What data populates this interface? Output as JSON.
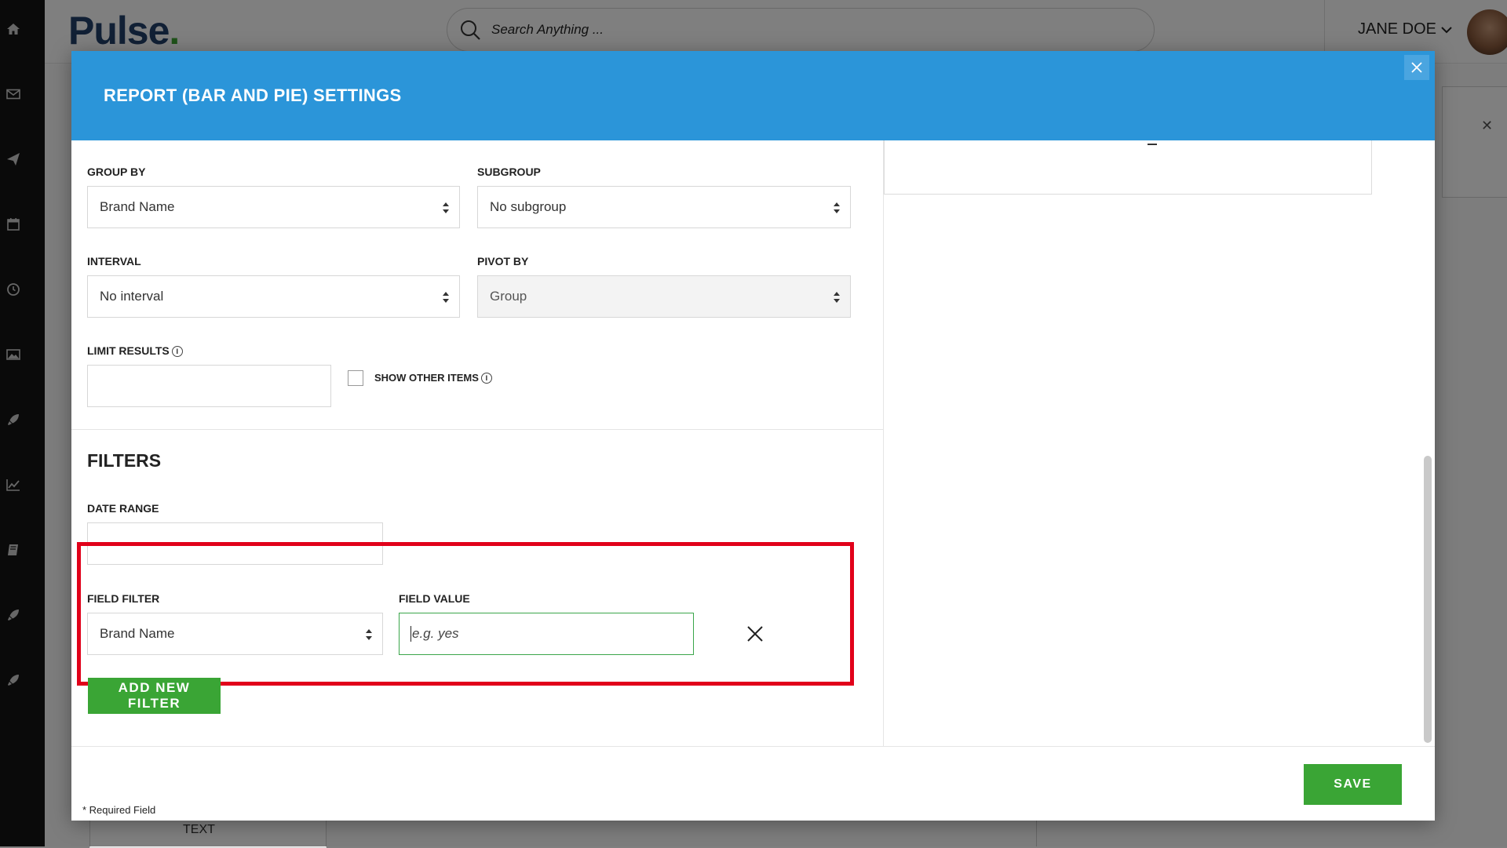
{
  "app": {
    "logo_text": "Pulse",
    "logo_dot": ".",
    "search": {
      "placeholder": "Search Anything ..."
    },
    "user": {
      "name": "JANE DOE"
    },
    "rail_icons": [
      "home-icon",
      "mail-icon",
      "send-icon",
      "calendar-icon",
      "clock-icon",
      "image-icon",
      "rocket-icon",
      "chart-line-icon",
      "book-icon",
      "rocket-icon",
      "rocket-icon"
    ],
    "background_tab_text": "TEXT"
  },
  "modal": {
    "title": "REPORT (BAR AND PIE) SETTINGS",
    "group_by": {
      "label": "GROUP BY",
      "value": "Brand Name"
    },
    "subgroup": {
      "label": "SUBGROUP",
      "value": "No subgroup"
    },
    "interval": {
      "label": "INTERVAL",
      "value": "No interval"
    },
    "pivot_by": {
      "label": "PIVOT BY",
      "value": "Group"
    },
    "limit_results": {
      "label": "LIMIT RESULTS",
      "value": ""
    },
    "show_other_items": {
      "label": "SHOW OTHER ITEMS",
      "checked": false
    },
    "filters": {
      "heading": "FILTERS",
      "date_range": {
        "label": "DATE RANGE",
        "value": ""
      },
      "field_filter": {
        "label": "FIELD FILTER",
        "value": "Brand Name"
      },
      "field_value": {
        "label": "FIELD VALUE",
        "placeholder": "e.g. yes",
        "value": ""
      },
      "add_button": "ADD NEW FILTER"
    },
    "footer": {
      "required_note": "* Required Field",
      "save_button": "SAVE"
    }
  },
  "colors": {
    "header_blue": "#2b95d9",
    "action_green": "#3aa535",
    "highlight_red": "#e1001a",
    "rail_dark": "#151515"
  }
}
